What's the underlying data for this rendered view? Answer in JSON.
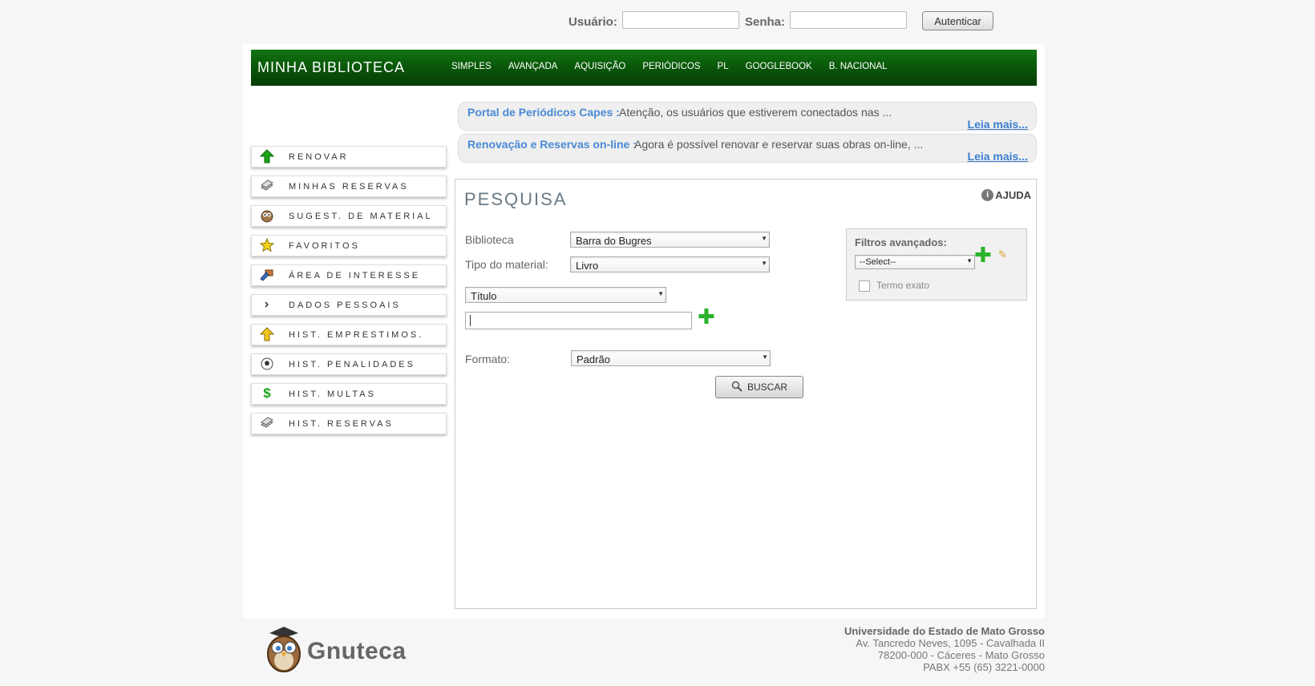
{
  "login": {
    "user_label": "Usuário:",
    "password_label": "Senha:",
    "user_value": "",
    "password_value": "",
    "button": "Autenticar"
  },
  "header": {
    "brand": "MINHA BIBLIOTECA",
    "nav": [
      "SIMPLES",
      "AVANÇADA",
      "AQUISIÇÃO",
      "PERIÓDICOS",
      "PL",
      "GOOGLEBOOK",
      "B. NACIONAL"
    ]
  },
  "news": [
    {
      "title": "Portal de Periódicos Capes :",
      "body": "Atenção, os usuários que estiverem conectados nas ...",
      "more": "Leia mais..."
    },
    {
      "title": "Renovação e Reservas on-line :",
      "body": "Agora é possível renovar e reservar suas obras on-line, ...",
      "more": "Leia mais..."
    }
  ],
  "sidebar": {
    "items": [
      {
        "label": "Renovar",
        "icon": "green-arrow-up-icon"
      },
      {
        "label": "Minhas Reservas",
        "icon": "books-icon"
      },
      {
        "label": "Sugest. de Material",
        "icon": "owl-icon"
      },
      {
        "label": "Favoritos",
        "icon": "star-icon"
      },
      {
        "label": "Área de interesse",
        "icon": "interest-icon"
      },
      {
        "label": "Dados Pessoais",
        "icon": "chevron-right-icon"
      },
      {
        "label": "Hist. Emprestimos.",
        "icon": "yellow-arrow-up-icon"
      },
      {
        "label": "Hist. Penalidades",
        "icon": "ball-icon"
      },
      {
        "label": "Hist. Multas",
        "icon": "dollar-icon"
      },
      {
        "label": "Hist. Reservas",
        "icon": "books-icon"
      }
    ]
  },
  "search": {
    "title": "PESQUISA",
    "help": "AJUDA",
    "library_label": "Biblioteca",
    "library_value": "Barra do Bugres",
    "material_label": "Tipo do material:",
    "material_value": "Livro",
    "field_value": "Título",
    "term_value": "",
    "format_label": "Formato:",
    "format_value": "Padrão",
    "button": "BUSCAR",
    "filters": {
      "title": "Filtros avançados:",
      "select_value": "--Select--",
      "exact_label": "Termo exato",
      "exact_checked": false
    }
  },
  "footer": {
    "logo": "Gnuteca",
    "address": [
      "Universidade do Estado de Mato Grosso",
      "Av. Tancredo Neves, 1095 - Cavalhada II",
      "78200-000 - Cáceres - Mato Grosso",
      "PABX +55 (65) 3221-0000"
    ]
  },
  "colors": {
    "header_green": "#0a5a0a",
    "link_blue": "#3d7fd0",
    "plus_green": "#2bb32b"
  }
}
